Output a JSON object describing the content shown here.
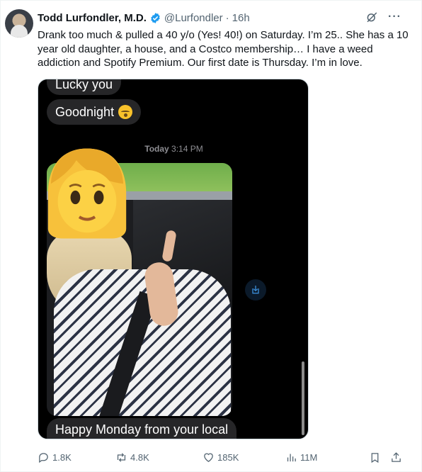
{
  "post": {
    "author_name": "Todd Lurfondler, M.D.",
    "handle": "@Lurfondler",
    "separator": "·",
    "time": "16h",
    "more": "···",
    "text": "Drank too much & pulled a 40 y/o (Yes! 40!) on Saturday. I’m 25.. She has a 10 year old daughter, a house, and a Costco membership… I have a weed addiction and Spotify Premium. Our first date is Thursday. I’m in love."
  },
  "screenshot": {
    "bubble_1": "Lucky you",
    "bubble_2": "Goodnight",
    "timestamp_day": "Today",
    "timestamp_time": "3:14 PM",
    "bubble_3": "Happy Monday from your local"
  },
  "actions": {
    "replies": "1.8K",
    "reposts": "4.8K",
    "likes": "185K",
    "views": "11M"
  },
  "colors": {
    "verified": "#1d9bf0",
    "muted": "#536471",
    "imessage_bubble": "#262628"
  },
  "icons": [
    "verified-badge-icon",
    "grok-icon",
    "more-icon",
    "sleepy-face-emoji",
    "woman-emoji",
    "save-icon",
    "reply-icon",
    "repost-icon",
    "like-icon",
    "views-icon",
    "bookmark-icon",
    "share-icon"
  ]
}
